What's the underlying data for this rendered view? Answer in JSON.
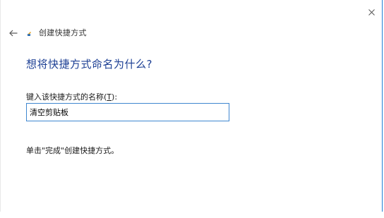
{
  "dialog": {
    "title": "创建快捷方式",
    "question": "想将快捷方式命名为什么?",
    "field_label_prefix": "键入该快捷方式的名称(",
    "field_label_access_key": "T",
    "field_label_suffix": "):",
    "name_value": "清空剪贴板",
    "hint": "单击\"完成\"创建快捷方式。"
  },
  "icons": {
    "close": "close-icon",
    "back": "back-arrow-icon",
    "wizard": "shortcut-wizard-icon"
  },
  "colors": {
    "question_text": "#1c3f94",
    "input_border": "#3f87d0",
    "window_border": "#1f7fd6"
  }
}
